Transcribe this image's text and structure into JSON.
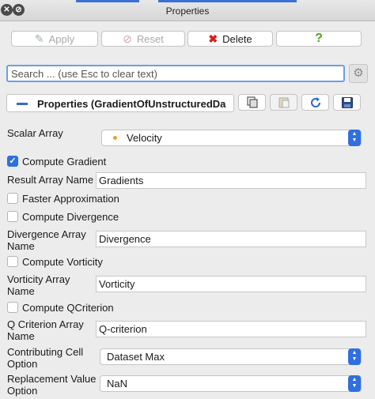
{
  "window": {
    "title": "Properties"
  },
  "toolbar": {
    "apply_label": "Apply",
    "reset_label": "Reset",
    "delete_label": "Delete",
    "help_label": "?"
  },
  "search": {
    "placeholder": "Search ... (use Esc to clear text)"
  },
  "section": {
    "title": "Properties (GradientOfUnstructuredDa"
  },
  "form": {
    "scalar_array_label": "Scalar Array",
    "scalar_array_value": "Velocity",
    "compute_gradient_label": "Compute Gradient",
    "compute_gradient_checked": true,
    "result_array_name_label": "Result Array Name",
    "result_array_name_value": "Gradients",
    "faster_approx_label": "Faster Approximation",
    "compute_divergence_label": "Compute Divergence",
    "divergence_array_label_1": "Divergence Array",
    "divergence_array_label_2": "Name",
    "divergence_array_value": "Divergence",
    "compute_vorticity_label": "Compute Vorticity",
    "vorticity_array_label_1": "Vorticity Array",
    "vorticity_array_label_2": "Name",
    "vorticity_array_value": "Vorticity",
    "compute_qcriterion_label": "Compute QCriterion",
    "qcriterion_array_label_1": "Q Criterion Array",
    "qcriterion_array_label_2": "Name",
    "qcriterion_array_value": "Q-criterion",
    "contributing_cell_label_1": "Contributing Cell",
    "contributing_cell_label_2": "Option",
    "contributing_cell_value": "Dataset Max",
    "replacement_value_label_1": "Replacement Value",
    "replacement_value_label_2": "Option",
    "replacement_value_value": "NaN"
  },
  "colors": {
    "accent": "#2f6fe0",
    "delete": "#d42020",
    "help": "#4aa31f"
  }
}
